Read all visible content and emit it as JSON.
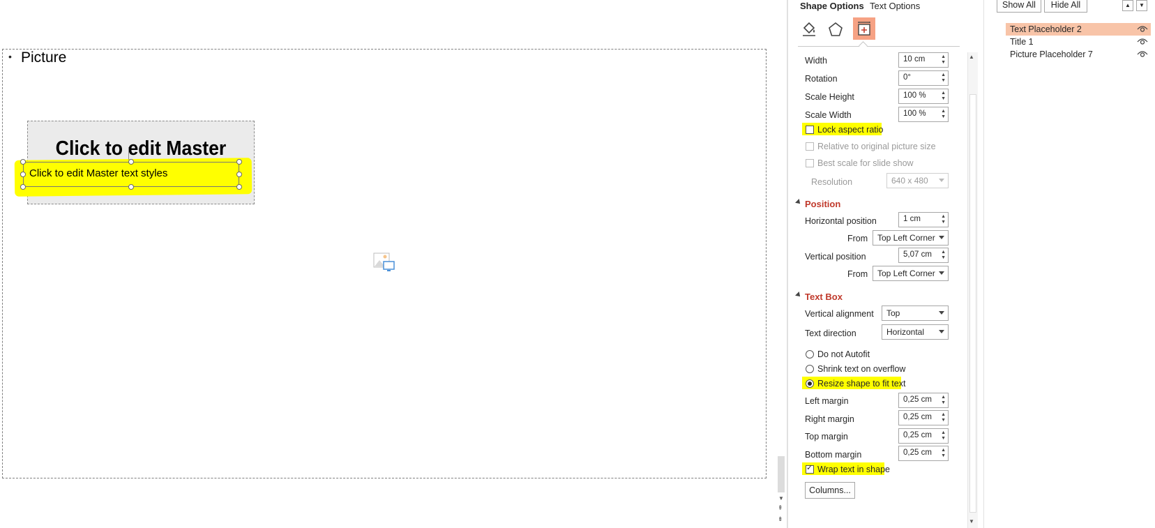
{
  "slide": {
    "bullet": "Picture",
    "title_placeholder_text": "Click to edit Master title style",
    "text_placeholder_text": "Click to edit Master text styles"
  },
  "pane": {
    "tabs": {
      "shape_options": "Shape Options",
      "text_options": "Text Options"
    },
    "size": {
      "width_label": "Width",
      "width_value": "10 cm",
      "rotation_label": "Rotation",
      "rotation_value": "0°",
      "scale_height_label": "Scale Height",
      "scale_height_value": "100 %",
      "scale_width_label": "Scale Width",
      "scale_width_value": "100 %",
      "lock_aspect_label": "Lock aspect ratio",
      "relative_label": "Relative to original picture size",
      "best_scale_label": "Best scale for slide show",
      "resolution_label": "Resolution",
      "resolution_value": "640 x 480"
    },
    "position": {
      "title": "Position",
      "horizontal_label": "Horizontal position",
      "horizontal_value": "1 cm",
      "from_label": "From",
      "horizontal_from": "Top Left Corner",
      "vertical_label": "Vertical position",
      "vertical_value": "5,07 cm",
      "vertical_from": "Top Left Corner"
    },
    "textbox": {
      "title": "Text Box",
      "valign_label": "Vertical alignment",
      "valign_value": "Top",
      "direction_label": "Text direction",
      "direction_value": "Horizontal",
      "autofit_options": [
        "Do not Autofit",
        "Shrink text on overflow",
        "Resize shape to fit text"
      ],
      "selected_autofit": "Resize shape to fit text",
      "left_margin_label": "Left margin",
      "left_margin_value": "0,25 cm",
      "right_margin_label": "Right margin",
      "right_margin_value": "0,25 cm",
      "top_margin_label": "Top margin",
      "top_margin_value": "0,25 cm",
      "bottom_margin_label": "Bottom margin",
      "bottom_margin_value": "0,25 cm",
      "wrap_label": "Wrap text in shape",
      "columns_button": "Columns..."
    }
  },
  "selection_pane": {
    "show_all": "Show All",
    "hide_all": "Hide All",
    "items": [
      "Text Placeholder 2",
      "Title 1",
      "Picture Placeholder 7"
    ],
    "selected_item": "Text Placeholder 2"
  },
  "colors": {
    "highlight": "#ffff00",
    "accent": "#c0392b",
    "selected_item_bg": "#f8c4a8"
  }
}
